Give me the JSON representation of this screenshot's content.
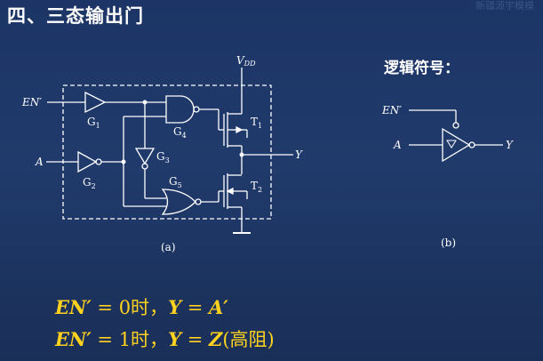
{
  "slide_title": "四、三态输出门",
  "logic_symbol_title": "逻辑符号：",
  "watermark": "新疆源宇模模",
  "circuit": {
    "vdd_label_main": "V",
    "vdd_label_sub": "DD",
    "en_label": "EN′",
    "a_label": "A",
    "y_label": "Y",
    "g1_main": "G",
    "g1_sub": "1",
    "g2_main": "G",
    "g2_sub": "2",
    "g3_main": "G",
    "g3_sub": "3",
    "g4_main": "G",
    "g4_sub": "4",
    "g5_main": "G",
    "g5_sub": "5",
    "t1_main": "T",
    "t1_sub": "1",
    "t2_main": "T",
    "t2_sub": "2",
    "caption": "(a)"
  },
  "symbol": {
    "en_label": "EN′",
    "a_label": "A",
    "y_label": "Y",
    "caption": "(b)"
  },
  "equations": {
    "line1_en": "EN′",
    "line1_eq": " = 0时，",
    "line1_y": "Y",
    "line1_eq2": " = ",
    "line1_a": "A′",
    "line2_en": "EN′",
    "line2_eq": " = 1时，",
    "line2_y": "Y",
    "line2_eq2": " = ",
    "line2_z": "Z",
    "line2_rest": "(高阻)"
  },
  "colors": {
    "background": "#1c3566",
    "line": "#ffffff",
    "equation": "#ffd21f"
  }
}
